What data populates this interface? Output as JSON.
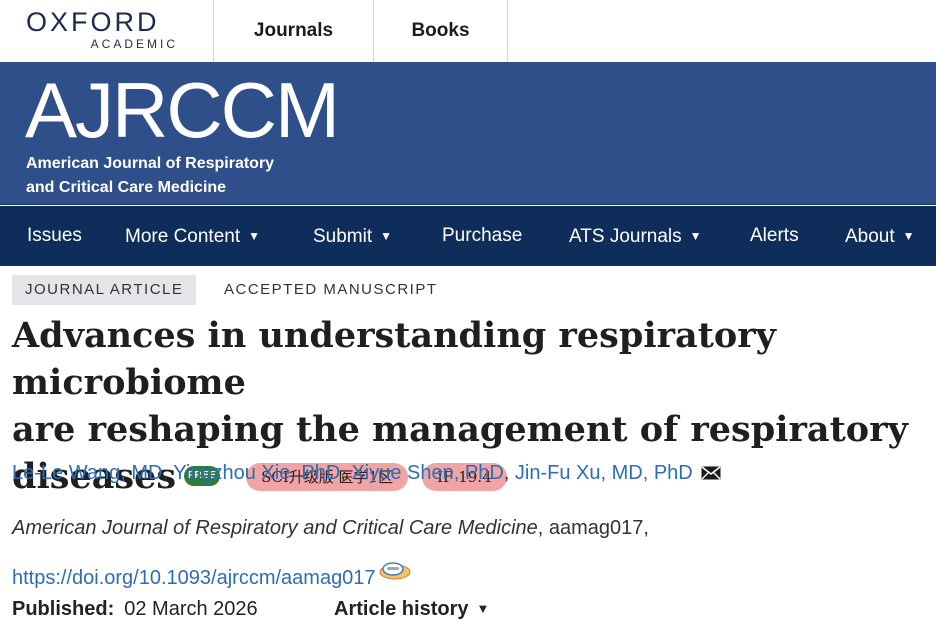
{
  "top_bar": {
    "logo_main": "OXFORD",
    "logo_sub": "ACADEMIC",
    "links": [
      "Journals",
      "Books"
    ]
  },
  "banner": {
    "logo": "AJRCCM",
    "subtitle_line1": "American Journal of Respiratory",
    "subtitle_line2": "and Critical Care Medicine"
  },
  "nav": {
    "items": [
      {
        "label": "Issues",
        "has_caret": false
      },
      {
        "label": "More Content",
        "has_caret": true
      },
      {
        "label": "Submit",
        "has_caret": true
      },
      {
        "label": "Purchase",
        "has_caret": false
      },
      {
        "label": "ATS Journals",
        "has_caret": true
      },
      {
        "label": "Alerts",
        "has_caret": false
      },
      {
        "label": "About",
        "has_caret": true
      }
    ],
    "caret_glyph": "▼"
  },
  "article": {
    "type_tag": "JOURNAL ARTICLE",
    "status_tag": "ACCEPTED MANUSCRIPT",
    "title_line1": "Advances in understanding respiratory microbiome",
    "title_line2": "are reshaping the management of respiratory",
    "title_line3": "diseases",
    "free_badge": "FREE",
    "pills": [
      "SCI升级版 医学1区",
      "IF 19.4"
    ],
    "authors": [
      "Le-Le Wang, MD",
      "Yingzhou Xie, PhD",
      "Xiyue Shen, PhD",
      "Jin-Fu Xu, MD, PhD"
    ],
    "author_separator": ", ",
    "journal_name": "American Journal of Respiratory and Critical Care Medicine",
    "article_id": ", aamag017,",
    "doi": "https://doi.org/10.1093/ajrccm/aamag017",
    "published_label": "Published:",
    "published_date": "02 March 2026",
    "history_label": "Article history"
  },
  "colors": {
    "banner": "#2e4f89",
    "nav": "#0f2d5a",
    "link": "#2d6db5",
    "free_badge": "#2e7d32",
    "pill": "#f0a4a4"
  }
}
